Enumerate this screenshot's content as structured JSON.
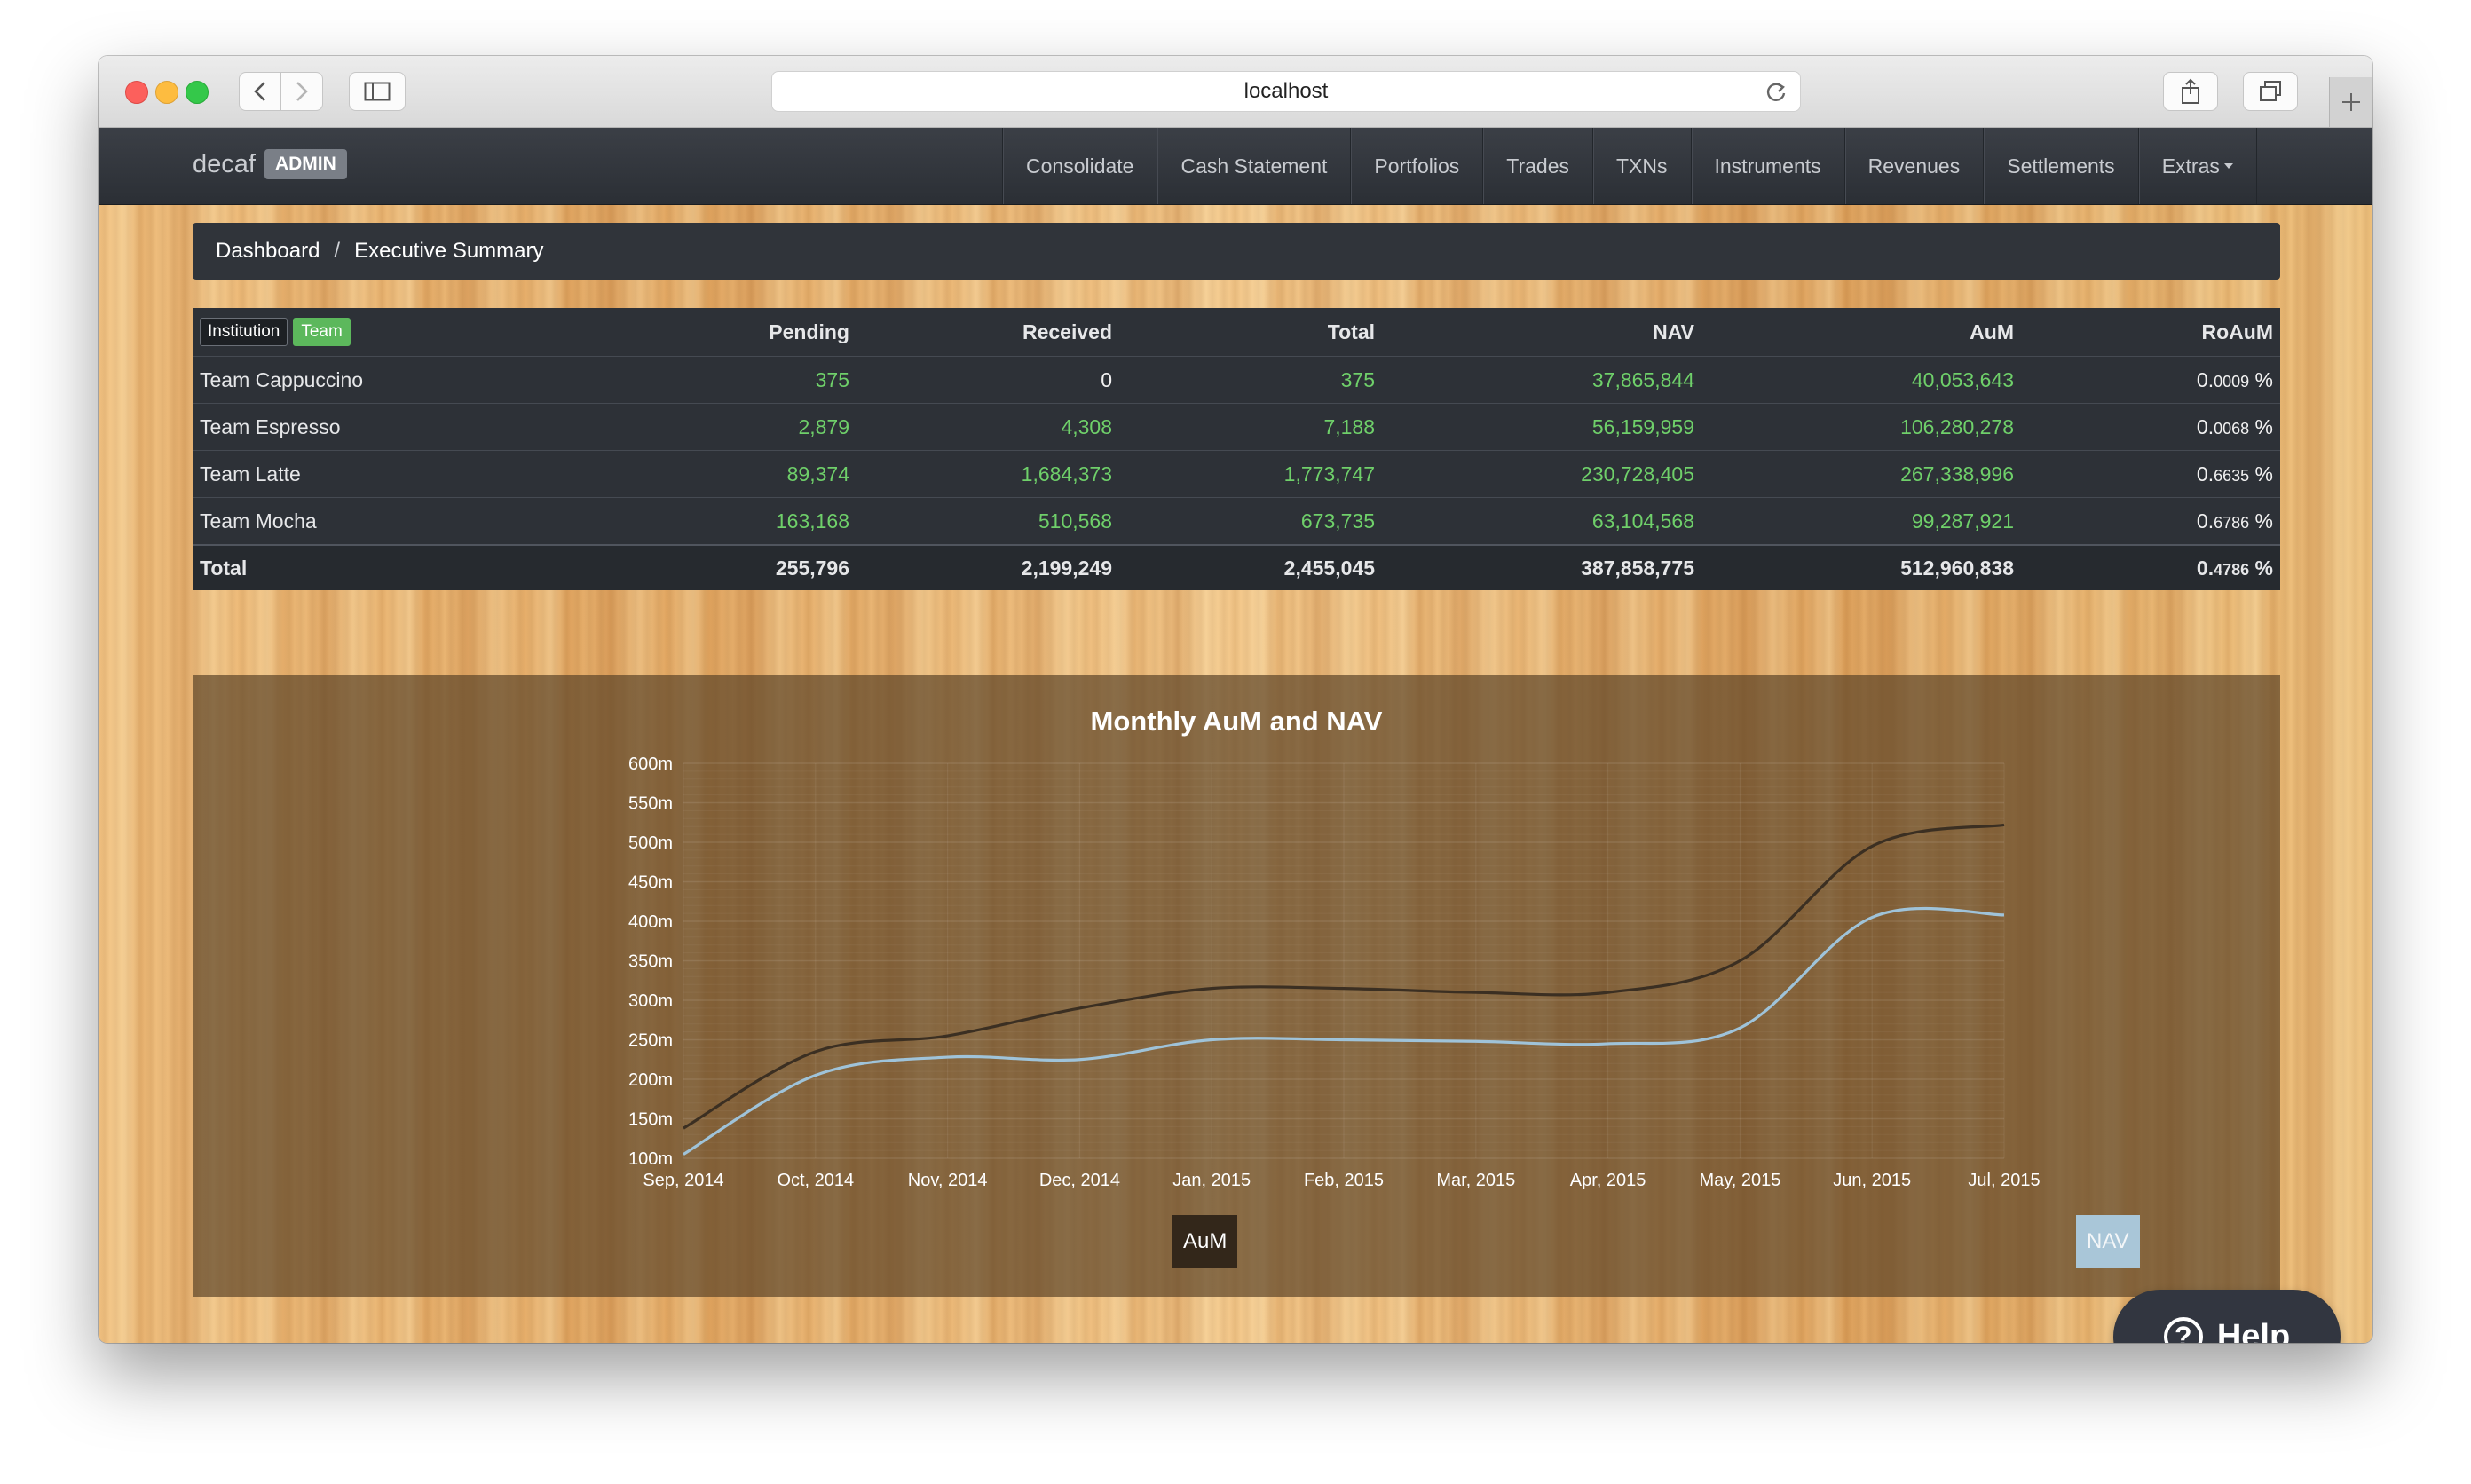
{
  "browser": {
    "address": "localhost"
  },
  "navbar": {
    "brand": "decaf",
    "badge": "ADMIN",
    "items": [
      {
        "label": "Consolidate"
      },
      {
        "label": "Cash Statement"
      },
      {
        "label": "Portfolios"
      },
      {
        "label": "Trades"
      },
      {
        "label": "TXNs"
      },
      {
        "label": "Instruments"
      },
      {
        "label": "Revenues"
      },
      {
        "label": "Settlements"
      },
      {
        "label": "Extras"
      }
    ]
  },
  "breadcrumb": {
    "home": "Dashboard",
    "separator": "/",
    "current": "Executive Summary"
  },
  "summary": {
    "toggle": {
      "institution": "Institution",
      "team": "Team"
    },
    "columns": [
      "Pending",
      "Received",
      "Total",
      "NAV",
      "AuM",
      "RoAuM"
    ],
    "rows": [
      {
        "name": "Team Cappuccino",
        "pending": "375",
        "received": "0",
        "total": "375",
        "nav": "37,865,844",
        "aum": "40,053,643",
        "roaum_main": "0.",
        "roaum_small": "0009",
        "roaum_unit": "%"
      },
      {
        "name": "Team Espresso",
        "pending": "2,879",
        "received": "4,308",
        "total": "7,188",
        "nav": "56,159,959",
        "aum": "106,280,278",
        "roaum_main": "0.",
        "roaum_small": "0068",
        "roaum_unit": "%"
      },
      {
        "name": "Team Latte",
        "pending": "89,374",
        "received": "1,684,373",
        "total": "1,773,747",
        "nav": "230,728,405",
        "aum": "267,338,996",
        "roaum_main": "0.",
        "roaum_small": "6635",
        "roaum_unit": "%"
      },
      {
        "name": "Team Mocha",
        "pending": "163,168",
        "received": "510,568",
        "total": "673,735",
        "nav": "63,104,568",
        "aum": "99,287,921",
        "roaum_main": "0.",
        "roaum_small": "6786",
        "roaum_unit": "%"
      }
    ],
    "total": {
      "name": "Total",
      "pending": "255,796",
      "received": "2,199,249",
      "total": "2,455,045",
      "nav": "387,858,775",
      "aum": "512,960,838",
      "roaum_main": "0.",
      "roaum_small": "4786",
      "roaum_unit": "%"
    }
  },
  "chart_data": {
    "type": "line",
    "title": "Monthly AuM and NAV",
    "x": [
      "Sep, 2014",
      "Oct, 2014",
      "Nov, 2014",
      "Dec, 2014",
      "Jan, 2015",
      "Feb, 2015",
      "Mar, 2015",
      "Apr, 2015",
      "May, 2015",
      "Jun, 2015",
      "Jul, 2015"
    ],
    "ylim": [
      100,
      600
    ],
    "yticks": [
      "100m",
      "150m",
      "200m",
      "250m",
      "300m",
      "350m",
      "400m",
      "450m",
      "500m",
      "550m",
      "600m"
    ],
    "series": [
      {
        "name": "AuM",
        "color": "#3b2f22",
        "values": [
          138,
          235,
          255,
          290,
          315,
          315,
          310,
          310,
          350,
          495,
          522
        ]
      },
      {
        "name": "NAV",
        "color": "#9fc3d9",
        "values": [
          105,
          205,
          228,
          225,
          250,
          250,
          248,
          245,
          265,
          405,
          408
        ]
      }
    ],
    "legend": "bottom-center",
    "grid": true
  },
  "help": {
    "label": "Help",
    "glyph": "?"
  }
}
